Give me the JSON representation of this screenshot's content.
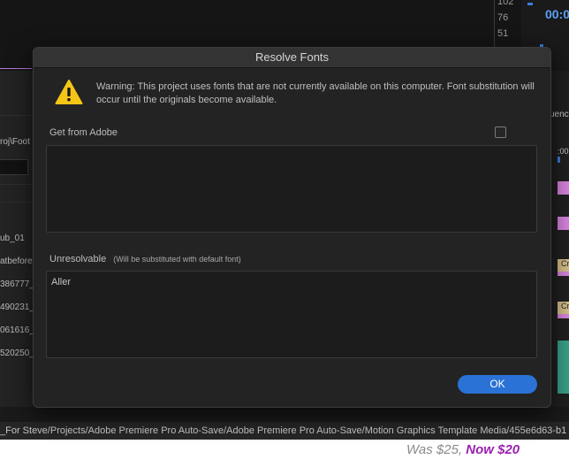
{
  "background": {
    "meter_values": [
      "102",
      "76",
      "51"
    ],
    "timecode": "00:0",
    "left_panel_rows": [
      "roj\\Foot",
      "ub_01",
      "atbefore",
      "386777_",
      "490231_",
      "061616_",
      "520250_"
    ],
    "right_tab": "uenc",
    "right_clip_labels": [
      "Cr",
      "Cr"
    ],
    "right_time": ":00",
    "project_path": "_For Steve/Projects/Adobe Premiere Pro Auto-Save/Adobe Premiere Pro Auto-Save/Motion Graphics Template Media/455e6d63-b1",
    "price_was": "Was $25,",
    "price_now": "Now $20"
  },
  "dialog": {
    "title": "Resolve Fonts",
    "warning": "Warning: This project uses fonts that are not currently available on this computer. Font substitution will occur until the originals become available.",
    "get_from_adobe_label": "Get from Adobe",
    "get_from_adobe_checked": false,
    "get_from_adobe_items": [],
    "unresolvable_label": "Unresolvable",
    "unresolvable_note": "(Will be substituted with default font)",
    "unresolvable_items": [
      "Aller"
    ],
    "ok_label": "OK"
  },
  "colors": {
    "accent": "#2a72d6",
    "warning_yellow": "#f5c518",
    "timecode_blue": "#5aa0f5"
  },
  "icons": [
    "warning-icon"
  ]
}
